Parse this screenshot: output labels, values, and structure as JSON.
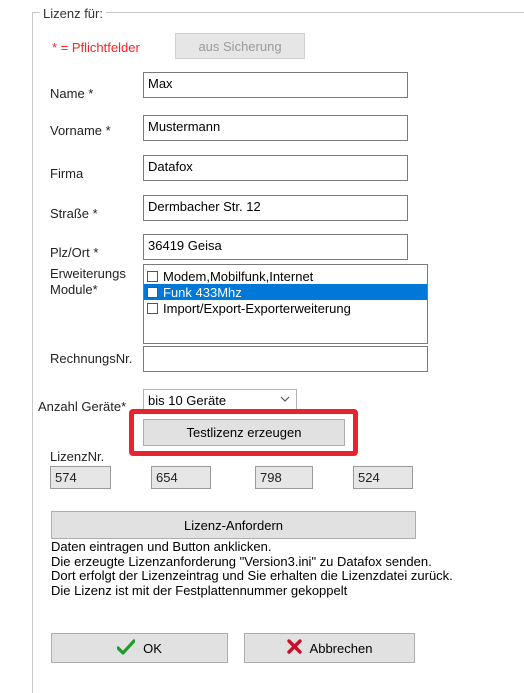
{
  "group": {
    "legend": "Lizenz für:"
  },
  "required_note": "* = Pflichtfelder",
  "restore_button": "aus Sicherung",
  "fields": {
    "name": {
      "label": "Name *",
      "value": "Max"
    },
    "vorname": {
      "label": "Vorname *",
      "value": "Mustermann"
    },
    "firma": {
      "label": "Firma",
      "value": "Datafox"
    },
    "strasse": {
      "label": "Straße *",
      "value": "Dermbacher Str. 12"
    },
    "plzort": {
      "label": "Plz/Ort *",
      "value": "36419 Geisa"
    },
    "rechnung": {
      "label": "RechnungsNr.",
      "value": ""
    }
  },
  "modules": {
    "label_line1": "Erweiterungs",
    "label_line2": "Module*",
    "items": [
      {
        "label": "Modem,Mobilfunk,Internet",
        "checked": false,
        "selected": false
      },
      {
        "label": "Funk 433Mhz",
        "checked": false,
        "selected": true
      },
      {
        "label": "Import/Export-Exporterweiterung",
        "checked": false,
        "selected": false
      }
    ]
  },
  "devices": {
    "label": "Anzahl Geräte*",
    "value": "bis  10 Geräte"
  },
  "test_license_button": "Testlizenz erzeugen",
  "license_nr": {
    "label": "LizenzNr.",
    "parts": [
      "574",
      "654",
      "798",
      "524"
    ]
  },
  "request_button": "Lizenz-Anfordern",
  "info_lines": [
    "Daten eintragen und Button anklicken.",
    "Die erzeugte Lizenzanforderung \"Version3.ini\" zu Datafox senden.",
    "Dort erfolgt der Lizenzeintrag und Sie erhalten die Lizenzdatei zurück.",
    "Die Lizenz ist mit der Festplattennummer gekoppelt"
  ],
  "ok_button": "OK",
  "cancel_button": "Abbrechen",
  "colors": {
    "required_red": "#ff2020",
    "highlight_red": "#e8222e",
    "selection_blue": "#0078d7",
    "ok_green": "#1f9a2b",
    "cancel_red": "#c8102e"
  },
  "icons": {
    "ok": "checkmark-icon",
    "cancel": "x-cross-icon",
    "combo": "chevron-down-icon"
  }
}
